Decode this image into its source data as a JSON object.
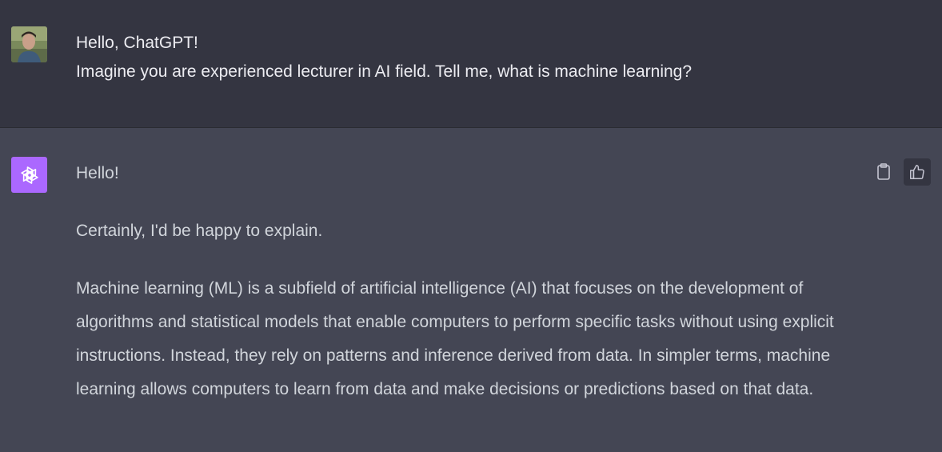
{
  "user_message": {
    "lines": [
      "Hello, ChatGPT!",
      "Imagine you are experienced lecturer in AI field. Tell me, what is machine learning?"
    ]
  },
  "assistant_message": {
    "paragraphs": [
      "Hello!",
      "Certainly, I'd be happy to explain.",
      "Machine learning (ML) is a subfield of artificial intelligence (AI) that focuses on the development of algorithms and statistical models that enable computers to perform specific tasks without using explicit instructions. Instead, they rely on patterns and inference derived from data. In simpler terms, machine learning allows computers to learn from data and make decisions or predictions based on that data."
    ]
  },
  "icons": {
    "user_avatar": "user-photo-avatar",
    "assistant_avatar": "openai-logo-icon",
    "copy": "clipboard-icon",
    "like": "thumbs-up-icon"
  },
  "colors": {
    "user_bg": "#343541",
    "assistant_bg": "#444654",
    "gpt_avatar_bg": "#ab68ff",
    "text": "#ececf1"
  }
}
